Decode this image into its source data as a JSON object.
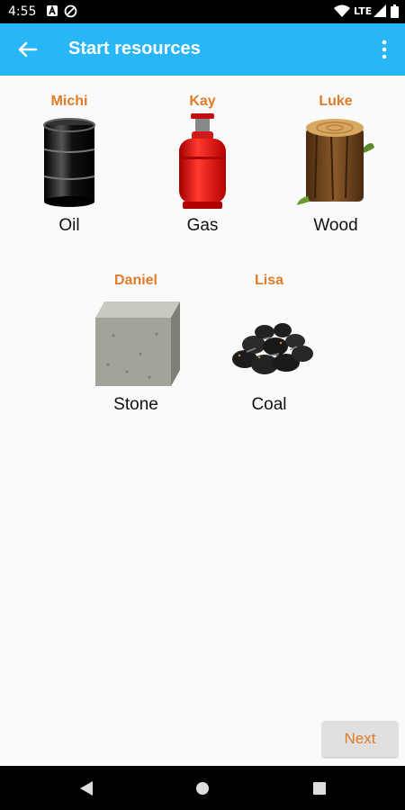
{
  "status_bar": {
    "time": "4:55",
    "network": "LTE",
    "icons": [
      "notification-a-icon",
      "data-saver-icon",
      "wifi-icon",
      "signal-icon",
      "battery-icon"
    ]
  },
  "app_bar": {
    "title": "Start resources",
    "background": "#29b6f6",
    "icons": [
      "back-arrow-icon",
      "more-vert-icon"
    ]
  },
  "resources": [
    {
      "owner": "Michi",
      "label": "Oil",
      "icon": "oil-barrel-icon"
    },
    {
      "owner": "Kay",
      "label": "Gas",
      "icon": "gas-cylinder-icon"
    },
    {
      "owner": "Luke",
      "label": "Wood",
      "icon": "wood-log-icon"
    },
    {
      "owner": "Daniel",
      "label": "Stone",
      "icon": "stone-block-icon"
    },
    {
      "owner": "Lisa",
      "label": "Coal",
      "icon": "coal-pile-icon"
    }
  ],
  "owner_color": "#e07b28",
  "next_button": {
    "label": "Next"
  },
  "nav_bar": {
    "icons": [
      "nav-back-icon",
      "nav-home-icon",
      "nav-recents-icon"
    ]
  }
}
